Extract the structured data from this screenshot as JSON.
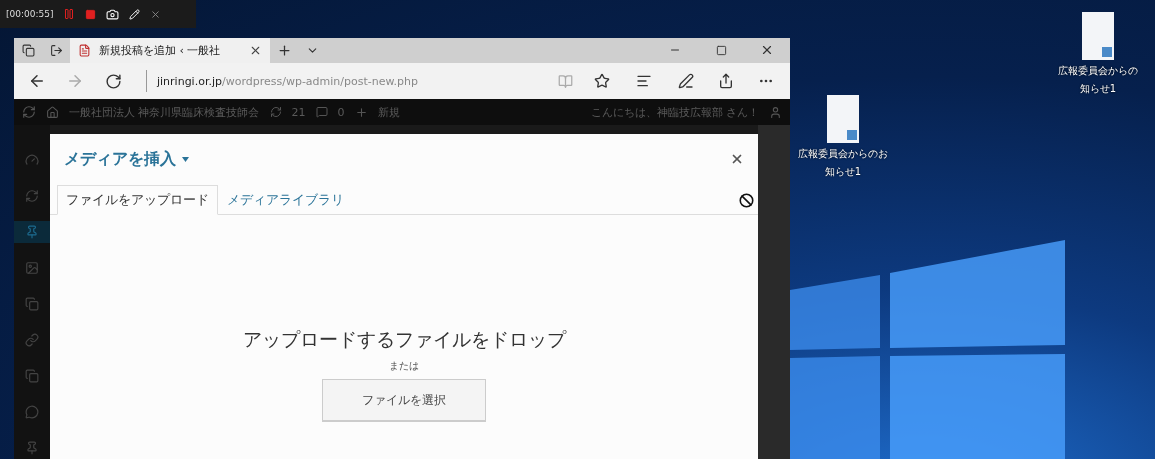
{
  "recorder": {
    "time": "[00:00:55]"
  },
  "browser": {
    "tab_title": "新規投稿を追加 ‹ 一般社",
    "url_host": "jinringi.or.jp",
    "url_path": "/wordpress/wp-admin/post-new.php"
  },
  "admin_bar": {
    "site_name": "一般社団法人 神奈川県臨床検査技師会",
    "updates": "21",
    "comments": "0",
    "new": "新規",
    "greeting": "こんにちは、神臨技広報部 さん！"
  },
  "sidebar": {
    "items": [
      {
        "kind": "dashboard",
        "selected": false
      },
      {
        "kind": "jetpack",
        "selected": false
      },
      {
        "kind": "posts",
        "selected": true
      },
      {
        "kind": "media",
        "selected": false
      },
      {
        "kind": "pages",
        "selected": false
      },
      {
        "kind": "links",
        "selected": false
      },
      {
        "kind": "pages",
        "selected": false
      },
      {
        "kind": "comments",
        "selected": false
      },
      {
        "kind": "posts",
        "selected": false
      }
    ]
  },
  "modal": {
    "title": "メディアを挿入",
    "tabs": [
      {
        "label": "ファイルをアップロード",
        "selected": true
      },
      {
        "label": "メディアライブラリ",
        "selected": false
      }
    ],
    "drop_text": "アップロードするファイルをドロップ",
    "or_text": "または",
    "select_button": "ファイルを選択"
  },
  "desktop_icons": [
    {
      "lines": [
        "広報委員会からの",
        "知らせ1"
      ]
    },
    {
      "lines": [
        "広報委員会からのお",
        "知らせ1"
      ]
    }
  ]
}
